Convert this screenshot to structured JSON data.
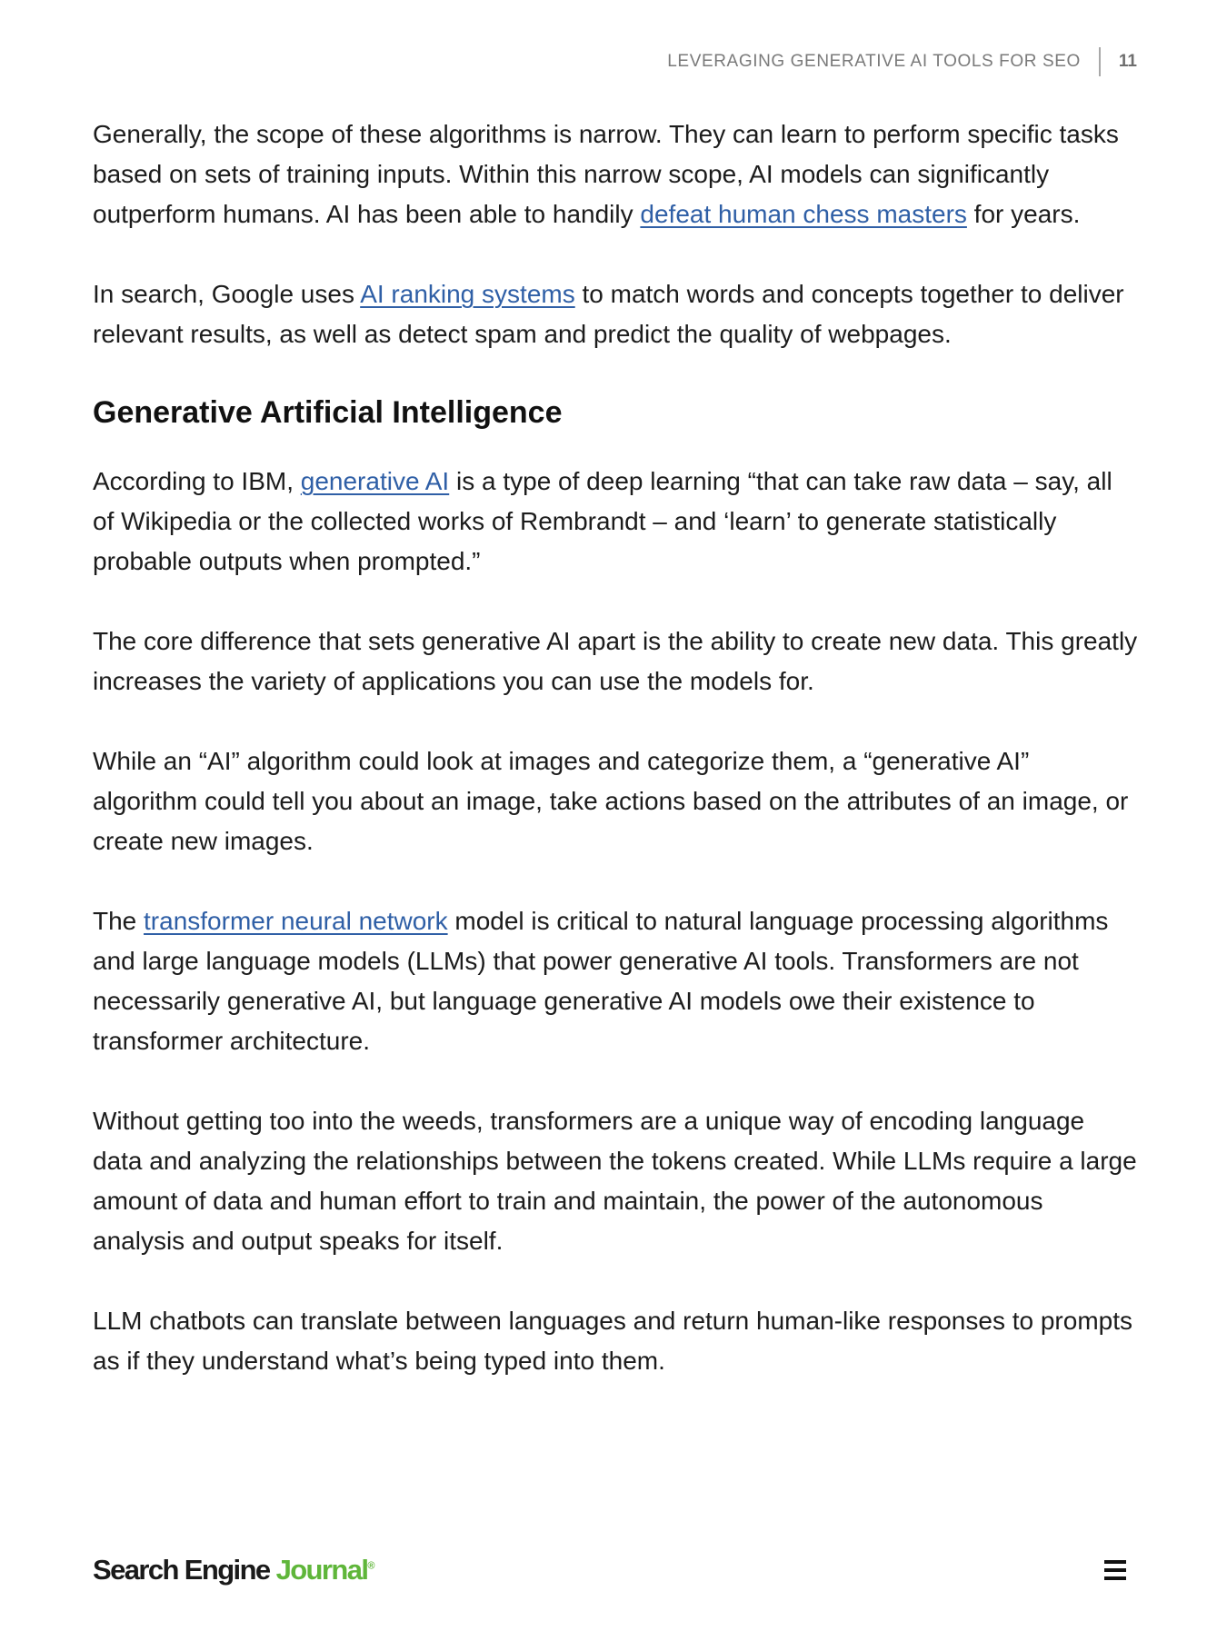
{
  "header": {
    "title": "LEVERAGING GENERATIVE AI TOOLS FOR SEO",
    "page_number": "11"
  },
  "body": {
    "p1": {
      "before_link": "Generally, the scope of these algorithms is narrow. They can learn to perform specific tasks based on sets of training inputs. Within this narrow scope, AI models can significantly outperform humans. AI has been able to handily ",
      "link": "defeat human chess masters",
      "after_link": " for years."
    },
    "p2": {
      "before_link": "In search, Google uses ",
      "link": "AI ranking systems",
      "after_link": " to match words and concepts together to deliver relevant results, as well as detect spam and predict the quality of webpages."
    },
    "heading": "Generative Artificial Intelligence",
    "p3": {
      "before_link": "According to IBM, ",
      "link": "generative AI",
      "after_link": " is a type of deep learning “that can take raw data – say, all of Wikipedia or the collected works of Rembrandt – and ‘learn’ to generate statistically probable outputs when prompted.”"
    },
    "p4": "The core difference that sets generative AI apart is the ability to create new data. This greatly increases the variety of applications you can use the models for.",
    "p5": "While an “AI” algorithm could look at images and categorize them, a “generative AI” algorithm could tell you about an image, take actions based on the attributes of an image, or create new images.",
    "p6": {
      "before_link": "The ",
      "link": "transformer neural network",
      "after_link": " model is critical to natural language processing algorithms and large language models (LLMs) that power generative AI tools. Transformers are not necessarily generative AI, but language generative AI models owe their existence to transformer architecture."
    },
    "p7": "Without getting too into the weeds, transformers are a unique way of encoding language data and analyzing the relationships between the tokens created. While LLMs require a large amount of data and human effort to train and maintain, the power of the autonomous analysis and output speaks for itself.",
    "p8": "LLM chatbots can translate between languages and return human-like responses to prompts as if they understand what’s being typed into them."
  },
  "footer": {
    "logo_part1": "Search Engine ",
    "logo_part2": "Journal",
    "logo_reg": "®",
    "menu_icon": "hamburger-menu-icon"
  },
  "colors": {
    "link": "#2f5fa6",
    "brand_green": "#5fb63a",
    "text": "#1c1c1c"
  }
}
